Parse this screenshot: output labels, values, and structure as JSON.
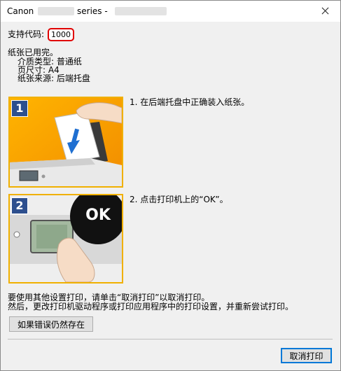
{
  "window": {
    "title_prefix": "Canon",
    "title_model": "series -"
  },
  "support_code": {
    "label": "支持代码:",
    "value": "1000"
  },
  "paper_info": {
    "heading": "纸张已用完。",
    "media_type": "介质类型:  普通纸",
    "page_size": "页尺寸:  A4",
    "paper_source": "纸张来源:  后端托盘"
  },
  "steps": [
    {
      "badge": "1",
      "text": "1.  在后端托盘中正确装入纸张。"
    },
    {
      "badge": "2",
      "text": "2.  点击打印机上的“OK”。"
    }
  ],
  "ok_label": "OK",
  "instructions": {
    "line1": "要使用其他设置打印，请单击“取消打印”以取消打印。",
    "line2": "然后，更改打印机驱动程序或打印应用程序中的打印设置，并重新尝试打印。"
  },
  "buttons": {
    "if_error_persists": "如果错误仍然存在",
    "cancel_print": "取消打印"
  },
  "colors": {
    "illustration_orange": "#f7a400",
    "step_badge_bg": "#2d4f8e",
    "code_highlight": "#e00000",
    "arrow_blue": "#1f6fd1"
  }
}
